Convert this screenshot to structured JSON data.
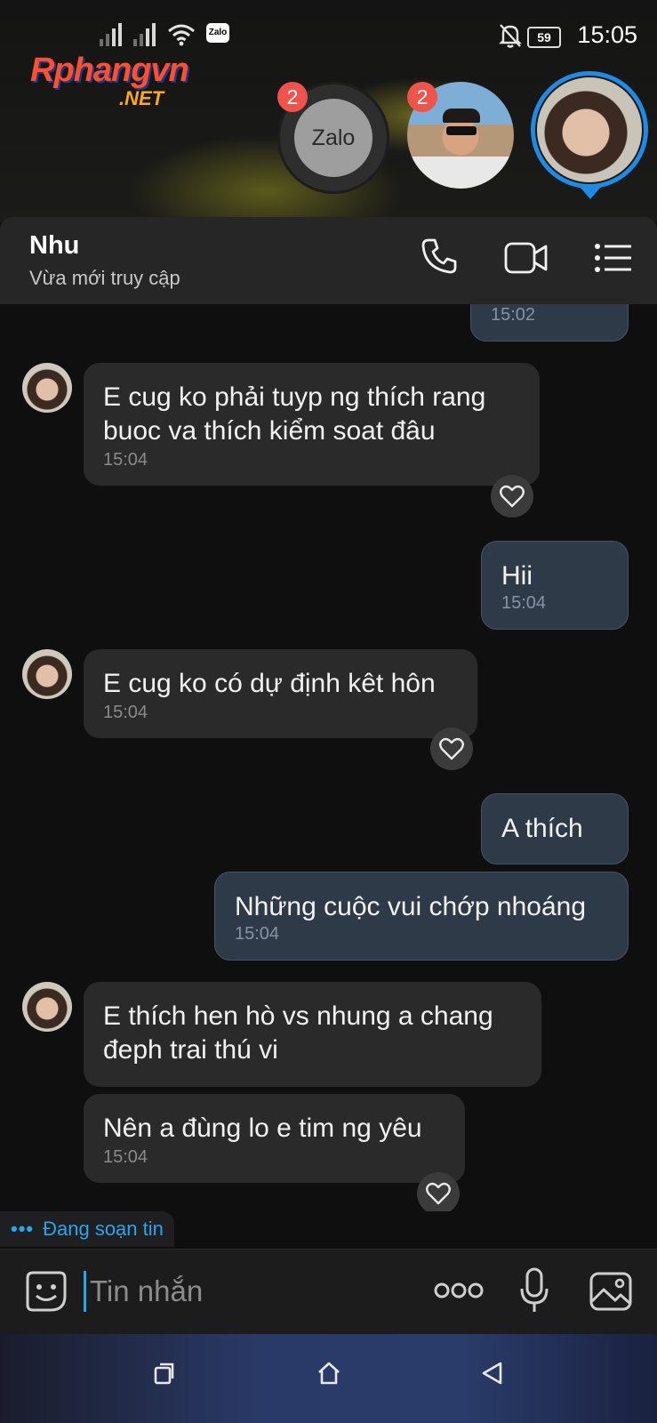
{
  "status_bar": {
    "time": "15:05",
    "battery": "59",
    "notif_app_label": "Zalo"
  },
  "watermark": {
    "main": "Rphangvn",
    "sub": ".NET"
  },
  "chat_heads": [
    {
      "name": "Zalo",
      "badge": "2"
    },
    {
      "name": "contact-man",
      "badge": "2"
    },
    {
      "name": "Nhu",
      "active": true
    }
  ],
  "header": {
    "name": "Nhu",
    "status": "Vừa mới truy cập",
    "accent": "#1e8ce6"
  },
  "messages": [
    {
      "dir": "out",
      "text": "",
      "time": "15:02"
    },
    {
      "dir": "in",
      "lines": [
        "E cug ko phải tuyp ng thích rang",
        "buoc va thích kiểm soat đâu"
      ],
      "time": "15:04"
    },
    {
      "dir": "out",
      "text": "Hii",
      "time": "15:04"
    },
    {
      "dir": "in",
      "text": "E cug ko có dự định kêt hôn",
      "time": "15:04"
    },
    {
      "dir": "out",
      "text": "A thích"
    },
    {
      "dir": "out",
      "text": "Những cuộc vui chớp nhoáng",
      "time": "15:04"
    },
    {
      "dir": "in",
      "lines": [
        "E thích hen hò vs nhung a chang",
        "đeph trai thú vi"
      ]
    },
    {
      "dir": "in",
      "text": "Nên a đùng lo e tim ng yêu",
      "time": "15:04"
    }
  ],
  "typing_indicator": {
    "dots": "•••",
    "text": "Đang soạn tin"
  },
  "input": {
    "placeholder": "Tin nhắn"
  }
}
